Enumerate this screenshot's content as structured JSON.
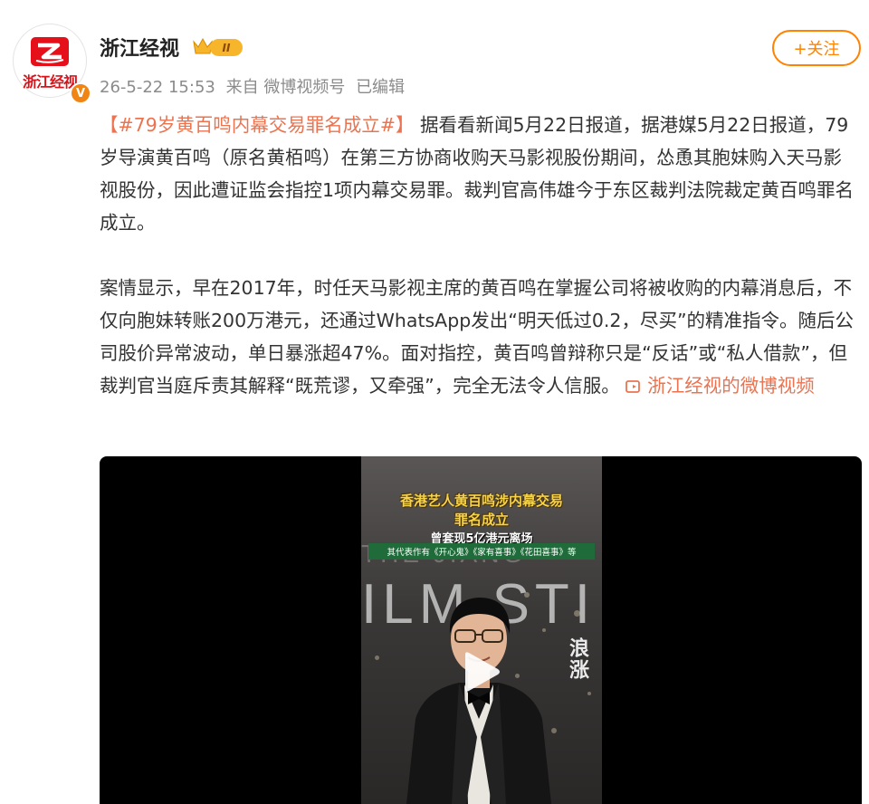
{
  "account": {
    "name": "浙江经视",
    "avatar_text": "浙江经视",
    "verified_mark": "V",
    "level_badge": "II",
    "icons": [
      "crown-icon",
      "verified-icon",
      "tv-logo-icon"
    ]
  },
  "post": {
    "timestamp": "26-5-22 15:53",
    "source": "来自 微博视频号",
    "edited": "已编辑",
    "follow_label": "+关注",
    "hashtag": "【#79岁黄百鸣内幕交易罪名成立#】",
    "paragraph1": "据看看新闻5月22日报道，据港媒5月22日报道，79岁导演黄百鸣（原名黄栢鸣）在第三方协商收购天马影视股份期间，怂恿其胞妹购入天马影视股份，因此遭证监会指控1项内幕交易罪。裁判官高伟雄今于东区裁判法院裁定黄百鸣罪名成立。",
    "paragraph2": "案情显示，早在2017年，时任天马影视主席的黄百鸣在掌握公司将被收购的内幕消息后，不仅向胞妹转账200万港元，还通过WhatsApp发出“明天低过0.2，尽买”的精准指令。随后公司股价异常波动，单日暴涨超47%。面对指控，黄百鸣曾辩称只是“反话”或“私人借款”，但裁判官当庭斥责其解释“既荒谬，又牵强”，完全无法令人信服。",
    "video_link": "浙江经视的微博视频"
  },
  "video": {
    "headline_line1": "香港艺人黄百鸣涉内幕交易",
    "headline_line2": "罪名成立",
    "headline_line3": "曾套现5亿港元离场",
    "works_line": "其代表作有《开心鬼》《家有喜事》《花田喜事》等",
    "backdrop_top": "THE JIANG",
    "backdrop_main": "ILM STI",
    "side_text": "浪涨",
    "icons": [
      "play-icon"
    ]
  },
  "colors": {
    "accent_orange": "#ff8200",
    "link_orange": "#eb7350",
    "meta_gray": "#8b8b8b",
    "brand_red": "#e5101a",
    "headline_yellow": "#f5d34a"
  }
}
